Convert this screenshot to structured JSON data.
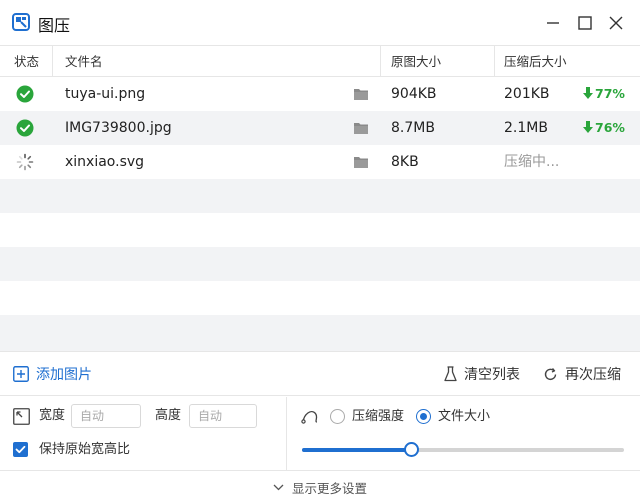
{
  "app": {
    "title": "图压",
    "accent_color": "#1f6fd0",
    "success_color": "#2aa53b"
  },
  "window_controls": [
    "minimize-icon",
    "maximize-icon",
    "close-icon"
  ],
  "table": {
    "headers": {
      "status": "状态",
      "filename": "文件名",
      "original_size": "原图大小",
      "compressed_size": "压缩后大小"
    },
    "rows": [
      {
        "status": "done",
        "status_icon": "check-circle-icon",
        "filename": "tuya-ui.png",
        "original_size": "904KB",
        "compressed_size": "201KB",
        "ratio": "77%"
      },
      {
        "status": "done",
        "status_icon": "check-circle-icon",
        "filename": "IMG739800.jpg",
        "original_size": "8.7MB",
        "compressed_size": "2.1MB",
        "ratio": "76%"
      },
      {
        "status": "processing",
        "status_icon": "spinner-icon",
        "filename": "xinxiao.svg",
        "original_size": "8KB",
        "compressed_size": "压缩中...",
        "ratio": ""
      }
    ]
  },
  "actions": {
    "add_images": "添加图片",
    "clear_list": "清空列表",
    "recompress": "再次压缩"
  },
  "settings": {
    "width_label": "宽度",
    "width_placeholder": "自动",
    "height_label": "高度",
    "height_placeholder": "自动",
    "keep_ratio_label": "保持原始宽高比",
    "keep_ratio_checked": true,
    "mode_options": [
      "压缩强度",
      "文件大小"
    ],
    "mode_selected": "文件大小",
    "slider_value": 0.34
  },
  "footer": {
    "more_settings": "显示更多设置"
  }
}
